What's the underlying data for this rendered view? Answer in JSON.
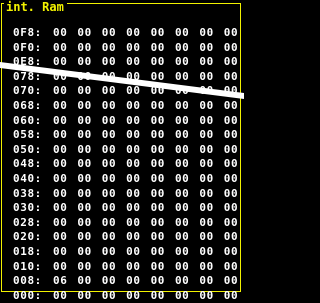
{
  "window": {
    "title": "int. Ram"
  },
  "colors": {
    "background": "#000000",
    "border": "#f2f200",
    "text": "#ffffff",
    "title": "#f2f200"
  },
  "memory": {
    "rows": [
      {
        "addr": "0F8:",
        "bytes": [
          "00",
          "00",
          "00",
          "00",
          "00",
          "00",
          "00",
          "00"
        ]
      },
      {
        "addr": "0F0:",
        "bytes": [
          "00",
          "00",
          "00",
          "00",
          "00",
          "00",
          "00",
          "00"
        ]
      },
      {
        "addr": "0E8:",
        "bytes": [
          "00",
          "00",
          "00",
          "00",
          "00",
          "00",
          "00",
          "00"
        ]
      },
      {
        "addr": "078:",
        "bytes": [
          "00",
          "00",
          "00",
          "00",
          "00",
          "00",
          "00",
          "00"
        ]
      },
      {
        "addr": "070:",
        "bytes": [
          "00",
          "00",
          "00",
          "00",
          "00",
          "00",
          "00",
          "00"
        ]
      },
      {
        "addr": "068:",
        "bytes": [
          "00",
          "00",
          "00",
          "00",
          "00",
          "00",
          "00",
          "00"
        ]
      },
      {
        "addr": "060:",
        "bytes": [
          "00",
          "00",
          "00",
          "00",
          "00",
          "00",
          "00",
          "00"
        ]
      },
      {
        "addr": "058:",
        "bytes": [
          "00",
          "00",
          "00",
          "00",
          "00",
          "00",
          "00",
          "00"
        ]
      },
      {
        "addr": "050:",
        "bytes": [
          "00",
          "00",
          "00",
          "00",
          "00",
          "00",
          "00",
          "00"
        ]
      },
      {
        "addr": "048:",
        "bytes": [
          "00",
          "00",
          "00",
          "00",
          "00",
          "00",
          "00",
          "00"
        ]
      },
      {
        "addr": "040:",
        "bytes": [
          "00",
          "00",
          "00",
          "00",
          "00",
          "00",
          "00",
          "00"
        ]
      },
      {
        "addr": "038:",
        "bytes": [
          "00",
          "00",
          "00",
          "00",
          "00",
          "00",
          "00",
          "00"
        ]
      },
      {
        "addr": "030:",
        "bytes": [
          "00",
          "00",
          "00",
          "00",
          "00",
          "00",
          "00",
          "00"
        ]
      },
      {
        "addr": "028:",
        "bytes": [
          "00",
          "00",
          "00",
          "00",
          "00",
          "00",
          "00",
          "00"
        ]
      },
      {
        "addr": "020:",
        "bytes": [
          "00",
          "00",
          "00",
          "00",
          "00",
          "00",
          "00",
          "00"
        ]
      },
      {
        "addr": "018:",
        "bytes": [
          "00",
          "00",
          "00",
          "00",
          "00",
          "00",
          "00",
          "00"
        ]
      },
      {
        "addr": "010:",
        "bytes": [
          "00",
          "00",
          "00",
          "00",
          "00",
          "00",
          "00",
          "00"
        ]
      },
      {
        "addr": "008:",
        "bytes": [
          "06",
          "00",
          "00",
          "00",
          "00",
          "00",
          "00",
          "00"
        ]
      },
      {
        "addr": "000:",
        "bytes": [
          "00",
          "00",
          "00",
          "00",
          "00",
          "00",
          "00",
          "00"
        ]
      }
    ]
  }
}
